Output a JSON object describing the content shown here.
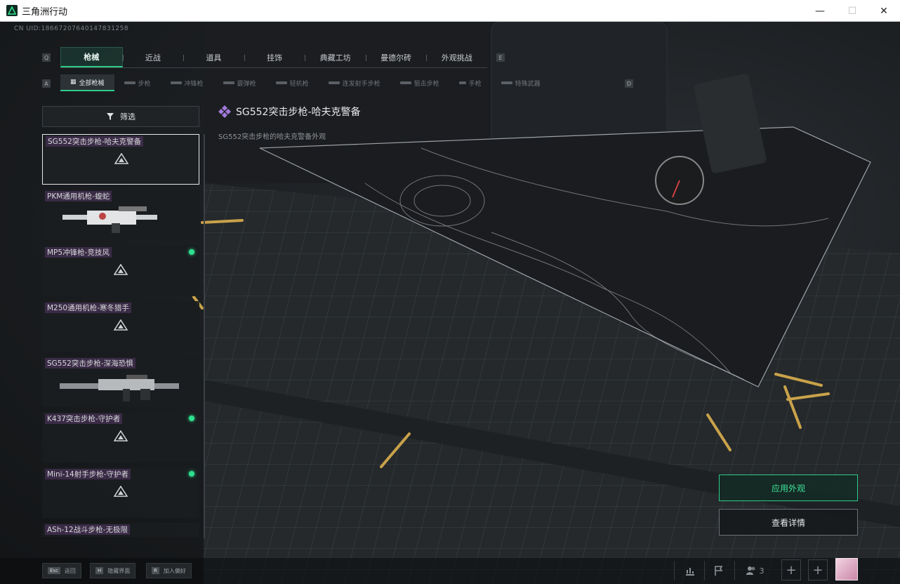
{
  "window": {
    "title": "三角洲行动",
    "minimize": "—",
    "maximize": "☐",
    "close": "✕"
  },
  "uid": "CN UID:18667207640147831258",
  "key_hints": {
    "q": "Q",
    "e": "E",
    "a": "A",
    "d": "D"
  },
  "tabs": [
    {
      "label": "枪械",
      "active": true
    },
    {
      "label": "近战",
      "active": false
    },
    {
      "label": "道具",
      "active": false
    },
    {
      "label": "挂饰",
      "active": false
    },
    {
      "label": "典藏工坊",
      "active": false
    },
    {
      "label": "曼德尔砖",
      "active": false
    },
    {
      "label": "外观挑战",
      "active": false
    }
  ],
  "subtabs": [
    {
      "label": "全部枪械",
      "active": true
    },
    {
      "label": "步枪",
      "active": false
    },
    {
      "label": "冲锋枪",
      "active": false
    },
    {
      "label": "霰弹枪",
      "active": false
    },
    {
      "label": "轻机枪",
      "active": false
    },
    {
      "label": "连发射手步枪",
      "active": false
    },
    {
      "label": "狙击步枪",
      "active": false
    },
    {
      "label": "手枪",
      "active": false
    },
    {
      "label": "特殊武器",
      "active": false
    }
  ],
  "filter": {
    "label": "筛选"
  },
  "skins": [
    {
      "name": "SG552突击步枪-哈夫克警备",
      "selected": true,
      "new": false,
      "image": "placeholder"
    },
    {
      "name": "PKM通用机枪-蝮蛇",
      "selected": false,
      "new": false,
      "image": "gun-pkm"
    },
    {
      "name": "MP5冲锋枪-竞技风",
      "selected": false,
      "new": true,
      "image": "placeholder"
    },
    {
      "name": "M250通用机枪-寒冬猎手",
      "selected": false,
      "new": false,
      "image": "placeholder"
    },
    {
      "name": "SG552突击步枪-深海恐惧",
      "selected": false,
      "new": false,
      "image": "gun-sg552"
    },
    {
      "name": "K437突击步枪-守护者",
      "selected": false,
      "new": true,
      "image": "placeholder"
    },
    {
      "name": "Mini-14射手步枪-守护者",
      "selected": false,
      "new": true,
      "image": "placeholder"
    },
    {
      "name": "ASh-12战斗步枪-无极限",
      "selected": false,
      "new": false,
      "image": "placeholder"
    }
  ],
  "detail": {
    "title": "SG552突击步枪-哈夫克警备",
    "description": "SG552突击步枪的哈夫克警备外观"
  },
  "actions": {
    "apply": "应用外观",
    "details": "查看详情"
  },
  "bottom_hints": [
    {
      "key": "Esc",
      "label": "返回"
    },
    {
      "key": "H",
      "label": "隐藏界面"
    },
    {
      "key": "R",
      "label": "加入偏好"
    }
  ],
  "squad_count": "3",
  "colors": {
    "accent": "#2ecc8a",
    "new_dot": "#2ee08f",
    "rarity": "#a07ad8"
  }
}
